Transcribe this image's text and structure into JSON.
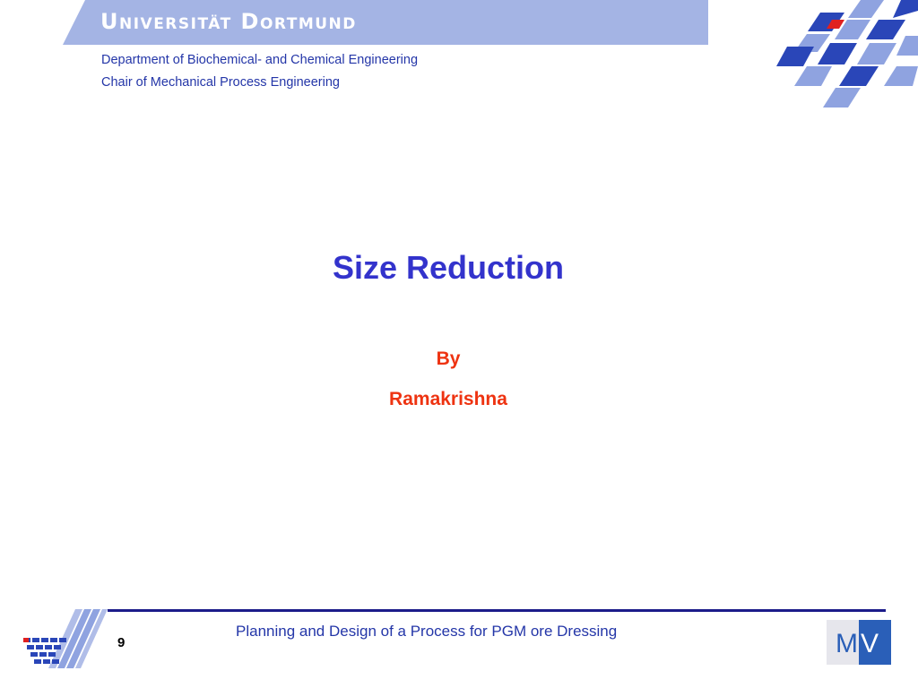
{
  "header": {
    "university": "Universität Dortmund",
    "department": "Department of Biochemical- and Chemical Engineering",
    "chair": "Chair of Mechanical Process Engineering"
  },
  "slide": {
    "title": "Size Reduction",
    "by": "By",
    "author": "Ramakrishna"
  },
  "footer": {
    "page_number": "9",
    "text": "Planning and Design of a Process for PGM ore Dressing"
  },
  "logos": {
    "mv_logo": "MV"
  },
  "colors": {
    "banner": "#a4b4e4",
    "title": "#3333cc",
    "author": "#ee3311",
    "dept_text": "#2436a8",
    "footer_line": "#1b1b8a",
    "pattern_dark": "#2a46b8",
    "pattern_light": "#8fa3e0",
    "pattern_red": "#e02020"
  }
}
